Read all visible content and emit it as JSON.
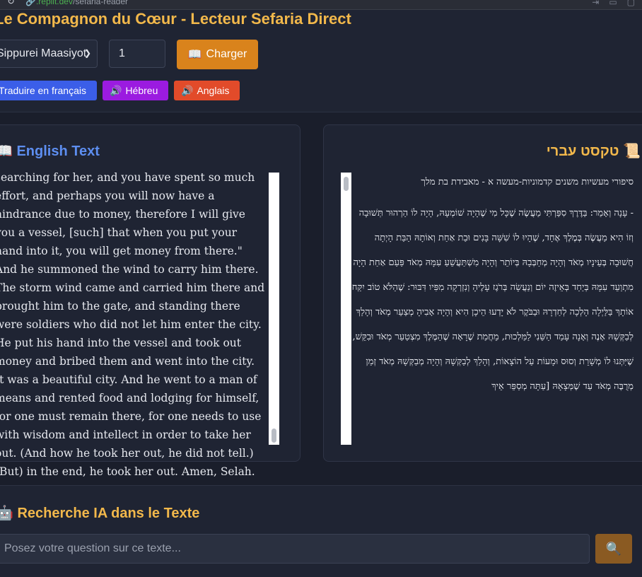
{
  "browser": {
    "url_domain": ".replit.dev",
    "url_path": "/sefaria-reader"
  },
  "header": {
    "title": "Le Compagnon du Cœur - Lecteur Sefaria Direct",
    "book_select_value": "Sippurei Maasiyot",
    "chapter_value": "1",
    "load_label": "Charger",
    "load_icon": "📖",
    "translate_label": "Traduire en français",
    "hebrew_label": "Hébreu",
    "english_label": "Anglais",
    "speaker_icon": "🔊"
  },
  "english_panel": {
    "icon": "📖",
    "title": "English Text",
    "text": "searching for her, and you have spent so much effort, and perhaps you will now have a hindrance due to money, therefore I will give you a vessel, [such] that when you put your hand into it, you will get money from there.\" And he summoned the wind to carry him there. The storm wind came and carried him there and brought him to the gate, and standing there were soldiers who did not let him enter the city. He put his hand into the vessel and took out money and bribed them and went into the city. It was a beautiful city. And he went to a man of means and rented food and lodging for himself, for one must remain there, for one needs to use with wisdom and intellect in order to take her out. (And how he took her out, he did not tell.) (But) in the end, he took her out. Amen, Selah."
  },
  "hebrew_panel": {
    "icon": "📜",
    "title": "טקסט עברי",
    "heading": "סיפורי מעשיות משנים קדמוניות-מעשה א - מאבידת בת מלך",
    "text": "- עָנָה וְאָמַר: בַּדֶּרֶךְ סִפַּרְתִּי מַעֲשֶׂה שֶׁכָּל מִי שֶׁהָיָה שׁוֹמְעָהּ, הָיָה לוֹ הַרְהוּר תְּשׁוּבָה וְזוֹ הִיא מַעֲשֶׂה בְּמֶלֶךְ אֶחָד, שֶׁהָיוּ לוֹ שִׁשָּׁה בָּנִים וּבַת אַחַת וְאוֹתָהּ הַבַּת הָיְתָה חֲשׁוּבָה בְּעֵינָיו מְאֹד וְהָיָה מְחַבְּבָהּ בְּיוֹתֵר וְהָיָה מִשְׁתַּעֲשֵׁעַ עִמָּהּ מְאֹד פַּעַם אַחַת הָיָה מִתְוַעֵד עִמָּהּ בְּיַחַד בְּאֵיזֶה יוֹם וְנַעֲשָׂה בְּרֹגֶז עָלֶיהָ וְנִזְרְקָה מִפִּיו דִּבּוּר: שֶׁהַלֹּא טוֹב יִקַּח אוֹתָךְ בַּלַּיְלָה הָלְכָה לְחַדְרָהּ וּבַבֹּקֶר לֹא יָדְעוּ הֵיכָן הִיא וְהָיָה אָבִיהָ מְצַעֵר מְאֹד וְהָלַךְ לְבַקְּשָׁהּ אָנֶה וְאָנָה עָמַד הַשֵּׁנִי לַמַּלְכוּת, מֵחֲמַת שֶׁרָאָה שֶׁהַמֶּלֶךְ מִצְטַעֵר מְאֹד וּבִקֵּשׁ, שֶׁיִּתְּנוּ לוֹ מְשָׁרֵת וְסוּס וּמָעוֹת עַל הוֹצָאוֹת, וְהָלַךְ לְבַקְּשָׁהּ וְהָיָה מְבַקְּשָׁהּ מְאֹד זְמַן מְרֻבֶּה מְאֹד עַד שֶׁמְּצָאָהּ [עַתָּה מְסַפֵּר אֵיךְ"
  },
  "ai": {
    "icon": "🤖",
    "title": "Recherche IA dans le Texte",
    "placeholder": "Posez votre question sur ce texte...",
    "search_icon": "🔍"
  }
}
